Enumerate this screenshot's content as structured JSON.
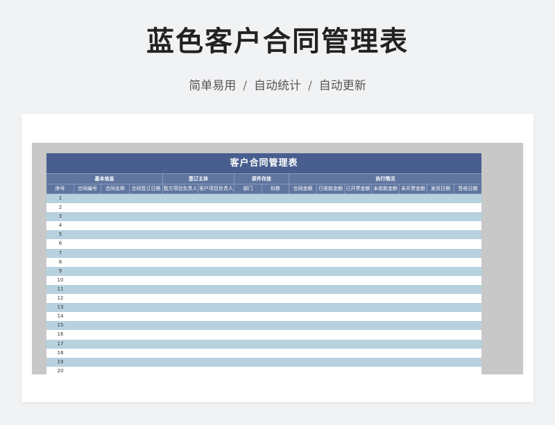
{
  "header": {
    "title": "蓝色客户合同管理表",
    "subtitle_parts": [
      "简单易用",
      "自动统计",
      "自动更新"
    ],
    "separator": "/"
  },
  "sheet": {
    "title": "客户合同管理表",
    "groups": [
      {
        "label": "基本信息"
      },
      {
        "label": "签订主体"
      },
      {
        "label": "原件存放"
      },
      {
        "label": "执行情况"
      }
    ],
    "columns": [
      {
        "label": "序号"
      },
      {
        "label": "合同编号"
      },
      {
        "label": "合同名称"
      },
      {
        "label": "合同签订日期"
      },
      {
        "label": "我方项目负责人"
      },
      {
        "label": "客户项目负责人"
      },
      {
        "label": "部门"
      },
      {
        "label": "份数"
      },
      {
        "label": "合同金额"
      },
      {
        "label": "已收款金额"
      },
      {
        "label": "已开票金额"
      },
      {
        "label": "未收款金额"
      },
      {
        "label": "未开票金额"
      },
      {
        "label": "发货日期"
      },
      {
        "label": "签收日期"
      }
    ],
    "rows": [
      "1",
      "2",
      "3",
      "4",
      "5",
      "6",
      "7",
      "8",
      "9",
      "10",
      "11",
      "12",
      "13",
      "14",
      "15",
      "16",
      "17",
      "18",
      "19",
      "20"
    ]
  },
  "colors": {
    "title_bar": "#485e8f",
    "header_bar": "#5f759f",
    "row_alt": "#b7d1df",
    "page_bg": "#f1f2f4"
  }
}
